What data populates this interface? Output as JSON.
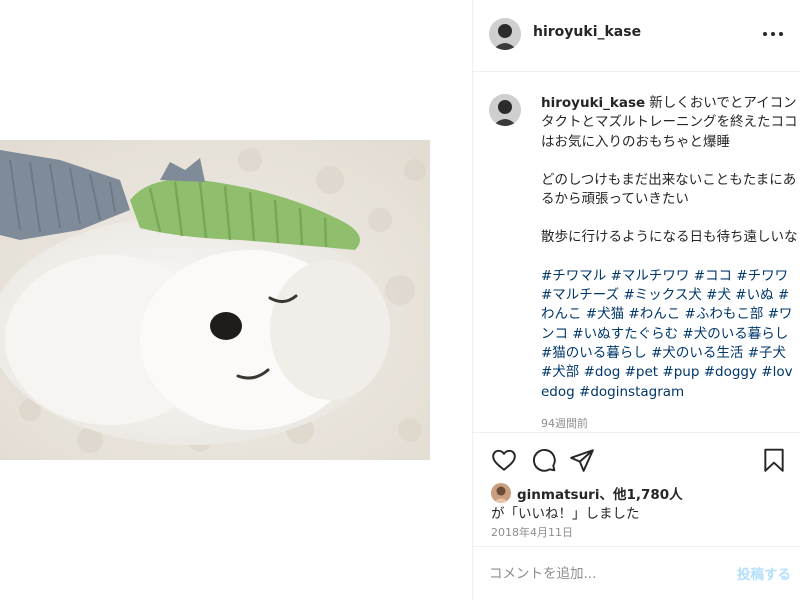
{
  "post": {
    "username": "hiroyuki_kase"
  },
  "caption": {
    "username": "hiroyuki_kase",
    "line1": "新しくおいでとアイコンタクトとマズルトレーニングを終えたココはお気に入りのおもちゃと爆睡",
    "line2": "どのしつけもまだ出来ないこともたまにあるから頑張っていきたい",
    "line3": "散歩に行けるようになる日も待ち遠しいな",
    "hashtags": [
      "#チワマル",
      "#マルチワワ",
      "#ココ",
      "#チワワ",
      "#マルチーズ",
      "#ミックス犬",
      "#犬",
      "#いぬ",
      "#わんこ",
      "#犬猫",
      "#わんこ",
      "#ふわもこ部",
      "#ワンコ",
      "#いぬすたぐらむ",
      "#犬のいる暮らし",
      "#猫のいる暮らし",
      "#犬のいる生活",
      "#子犬",
      "#犬部",
      "#dog",
      "#pet",
      "#pup",
      "#doggy",
      "#lovedog",
      "#doginstagram"
    ],
    "time_ago": "94週間前"
  },
  "likes": {
    "liker": "ginmatsuri",
    "others": "、他1,780人",
    "suffix": "が「いいね！」しました"
  },
  "date": "2018年4月11日",
  "comment": {
    "placeholder": "コメントを追加...",
    "post_label": "投稿する"
  },
  "colors": {
    "link": "#00376b",
    "muted": "#8e8e8e",
    "post_button_disabled": "#b2dffc",
    "border": "#efefef"
  },
  "icons": {
    "more": "more-horizontal-icon",
    "like": "heart-icon",
    "comment": "comment-bubble-icon",
    "share": "paper-plane-icon",
    "save": "bookmark-icon"
  }
}
